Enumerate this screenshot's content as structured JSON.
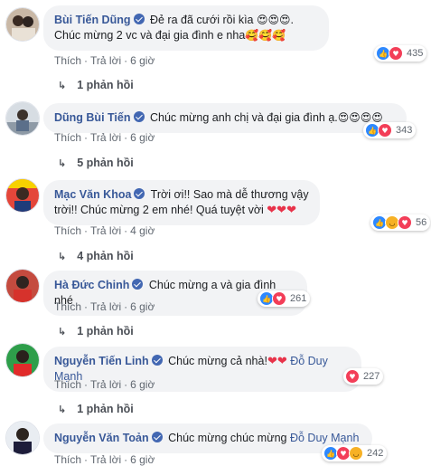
{
  "action_labels": {
    "like": "Thích",
    "reply": "Trả lời"
  },
  "comments": [
    {
      "author": "Bùi Tiến Dũng",
      "text": " Đẻ ra đã cưới rồi kìa ",
      "emoji1": "😍😍😍",
      "text2": ". Chúc mừng 2 vc và đại gia đình e nha",
      "emoji2": "🥰🥰🥰",
      "reactions": [
        "like",
        "love"
      ],
      "count": "435",
      "time": "6 giờ",
      "replies": "1 phản hồi"
    },
    {
      "author": "Dũng Bùi Tiến",
      "text": " Chúc mừng anh chị và đại gia đình ạ.",
      "emoji1": "😍😍😍😍",
      "reactions": [
        "like",
        "love"
      ],
      "count": "343",
      "time": "6 giờ",
      "replies": "5 phản hồi"
    },
    {
      "author": "Mạc Văn Khoa",
      "text": " Trời ơi!! Sao mà dễ thương vậy trời!! Chúc mừng 2 em nhé! Quá tuyệt vời ",
      "hearts": "❤❤❤",
      "reactions": [
        "like",
        "haha",
        "love"
      ],
      "count": "56",
      "time": "4 giờ",
      "replies": "4 phản hồi"
    },
    {
      "author": "Hà Đức Chinh",
      "text": " Chúc mừng a và gia đình nhé",
      "reactions": [
        "like",
        "love"
      ],
      "count": "261",
      "time": "6 giờ",
      "replies": "1 phản hồi"
    },
    {
      "author": "Nguyễn Tiến Linh",
      "text": " Chúc mừng cả nhà!",
      "hearts": "❤❤",
      "tag": " Đỗ Duy Mạnh",
      "reactions": [
        "love"
      ],
      "count": "227",
      "time": "6 giờ",
      "replies": "1 phản hồi"
    },
    {
      "author": "Nguyễn Văn Toản",
      "text": " Chúc mừng chúc mừng ",
      "tag": "Đỗ Duy Mạnh",
      "reactions": [
        "like",
        "love",
        "haha"
      ],
      "count": "242",
      "time": "6 giờ"
    }
  ]
}
